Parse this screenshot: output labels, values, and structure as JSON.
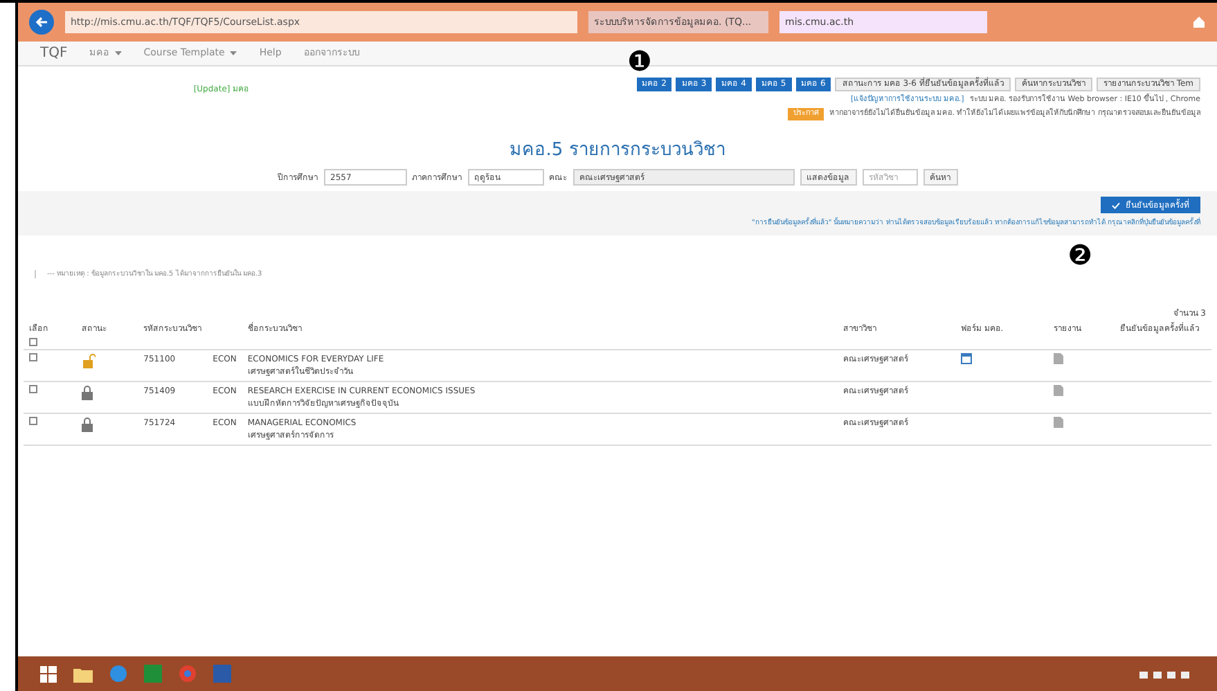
{
  "browser": {
    "url": "http://mis.cmu.ac.th/TQF/TQF5/CourseList.aspx",
    "tabs": [
      {
        "title": "ระบบบริหารจัดการข้อมูลมคอ. (TQ...",
        "selected": false
      },
      {
        "title": "mis.cmu.ac.th",
        "selected": true
      }
    ]
  },
  "navbar": {
    "brand": "TQF",
    "items": [
      {
        "label": "มคอ",
        "dropdown": true
      },
      {
        "label": "Course Template",
        "dropdown": true
      },
      {
        "label": "Help",
        "dropdown": false
      },
      {
        "label": "ออกจากระบบ",
        "dropdown": false
      }
    ]
  },
  "update_link": "[Update] มคอ",
  "tqf_buttons": [
    {
      "label": "มคอ 2",
      "kind": "primary"
    },
    {
      "label": "มคอ 3",
      "kind": "primary"
    },
    {
      "label": "มคอ 4",
      "kind": "primary"
    },
    {
      "label": "มคอ 5",
      "kind": "primary"
    },
    {
      "label": "มคอ 6",
      "kind": "primary"
    },
    {
      "label": "สถานะการ มคอ 3-6 ที่ยืนยันข้อมูลครั้งที่แล้ว",
      "kind": "default"
    },
    {
      "label": "ค้นหากระบวนวิชา",
      "kind": "default"
    },
    {
      "label": "รายงานกระบวนวิชา Tem",
      "kind": "default"
    }
  ],
  "help_line": {
    "link": "[แจ้งปัญหาการใช้งานระบบ มคอ.]",
    "text": "ระบบ มคอ. รองรับการใช้งาน Web browser : IE10 ขึ้นไป , Chrome"
  },
  "notice": {
    "badge": "ประกาศ",
    "text": "หากอาจารย์ยังไม่ได้ยืนยันข้อมูล มคอ. ทำให้ยังไม่ได้เผยแพร่ข้อมูลให้กับนักศึกษา กรุณาตรวจสอบและยืนยันข้อมูล"
  },
  "markers": [
    {
      "label": "❶",
      "kind": "one"
    },
    {
      "label": "❷",
      "kind": "two"
    }
  ],
  "page_title": "มคอ.5 รายการกระบวนวิชา",
  "filters": {
    "year_label": "ปีการศึกษา",
    "year": "2557",
    "term_label": "ภาคการศึกษา",
    "term": "ฤดูร้อน",
    "faculty_label": "คณะ",
    "faculty": "คณะเศรษฐศาสตร์",
    "show_button": "แสดงข้อมูล",
    "search_placeholder": "รหัสวิชา",
    "search_button": "ค้นหา"
  },
  "confirm_button": "ยืนยันข้อมูลครั้งที่",
  "note": "\"การยืนยันข้อมูลครั้งที่แล้ว\" นั้นหมายความว่า ท่านได้ตรวจสอบข้อมูลเรียบร้อยแล้ว หากต้องการแก้ไขข้อมูลสามารถทำได้ กรุณาคลิกที่ปุ่มยืนยันข้อมูลครั้งที่",
  "breadcrumb": "--- หมายเหตุ : ข้อมูลกระบวนวิชาใน มคอ.5 ได้มาจากการยืนยันใน มคอ.3",
  "count": "จำนวน 3",
  "table": {
    "columns": [
      "เลือก",
      "สถานะ",
      "รหัสกระบวนวิชา",
      "ชื่อกระบวนวิชา",
      "สาขาวิชา",
      "ฟอร์ม มคอ.",
      "รายงาน",
      "ยืนยันข้อมูลครั้งที่แล้ว"
    ],
    "select_all": false,
    "rows": [
      {
        "checked": false,
        "locked": false,
        "code": "751100",
        "dept": "ECON",
        "name_en": "ECONOMICS FOR EVERYDAY LIFE",
        "name_th": "เศรษฐศาสตร์ในชีวิตประจำวัน",
        "major": "คณะเศรษฐศาสตร์",
        "has_form": true
      },
      {
        "checked": false,
        "locked": true,
        "code": "751409",
        "dept": "ECON",
        "name_en": "RESEARCH EXERCISE IN CURRENT ECONOMICS ISSUES",
        "name_th": "แบบฝึกหัดการวิจัยปัญหาเศรษฐกิจปัจจุบัน",
        "major": "คณะเศรษฐศาสตร์",
        "has_form": false
      },
      {
        "checked": false,
        "locked": true,
        "code": "751724",
        "dept": "ECON",
        "name_en": "MANAGERIAL ECONOMICS",
        "name_th": "เศรษฐศาสตร์การจัดการ",
        "major": "คณะเศรษฐศาสตร์",
        "has_form": false
      }
    ]
  }
}
